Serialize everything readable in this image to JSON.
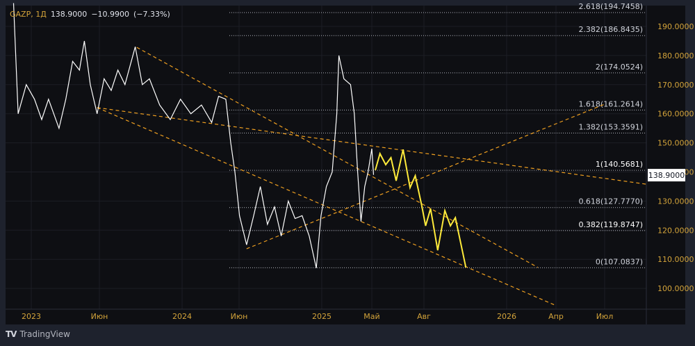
{
  "legend": {
    "symbol": "GAZP, 1Д",
    "price": "138.9000",
    "change": "−10.9900",
    "change_pct": "(−7.33%)"
  },
  "branding": {
    "name": "TradingView"
  },
  "colors": {
    "background": "#0e0f13",
    "price_line": "#ffffff",
    "projection": "#ffeb3b",
    "trendlines": "#f0a020",
    "axis_text": "#d4a43a",
    "fib_text": "#d1d4dc"
  },
  "chart_data": {
    "type": "line",
    "ylim": [
      95,
      195
    ],
    "grid": true,
    "y_ticks": [
      100,
      110,
      120,
      130,
      140,
      150,
      160,
      170,
      180,
      190
    ],
    "y_tick_labels": [
      "100.0000",
      "110.0000",
      "120.0000",
      "130.0000",
      "140.0000",
      "150.0000",
      "160.0000",
      "170.0000",
      "180.0000",
      "190.0000"
    ],
    "x_ticks": [
      {
        "label": "2023",
        "date": "2023-01-01"
      },
      {
        "label": "Июн",
        "date": "2023-06-01"
      },
      {
        "label": "2024",
        "date": "2024-01-01"
      },
      {
        "label": "Июн",
        "date": "2024-06-01"
      },
      {
        "label": "2025",
        "date": "2025-01-01"
      },
      {
        "label": "Май",
        "date": "2025-05-01"
      },
      {
        "label": "Авг",
        "date": "2025-08-01"
      },
      {
        "label": "2026",
        "date": "2026-01-01"
      },
      {
        "label": "Апр",
        "date": "2026-04-01"
      },
      {
        "label": "Июл",
        "date": "2026-07-01"
      }
    ],
    "last_price": {
      "value": 138.9,
      "label": "138.9000"
    },
    "price": [
      [
        "2022-11-22",
        198
      ],
      [
        "2022-12-02",
        160
      ],
      [
        "2022-12-20",
        170
      ],
      [
        "2023-01-08",
        165
      ],
      [
        "2023-01-24",
        158
      ],
      [
        "2023-02-09",
        165
      ],
      [
        "2023-03-02",
        155
      ],
      [
        "2023-03-17",
        165
      ],
      [
        "2023-04-02",
        178
      ],
      [
        "2023-04-17",
        175
      ],
      [
        "2023-04-28",
        185
      ],
      [
        "2023-05-11",
        170
      ],
      [
        "2023-05-26",
        160
      ],
      [
        "2023-06-13",
        172
      ],
      [
        "2023-07-01",
        168
      ],
      [
        "2023-07-18",
        175
      ],
      [
        "2023-08-06",
        170
      ],
      [
        "2023-09-02",
        183
      ],
      [
        "2023-09-20",
        170
      ],
      [
        "2023-10-08",
        172
      ],
      [
        "2023-11-04",
        163
      ],
      [
        "2023-12-01",
        158
      ],
      [
        "2023-12-27",
        165
      ],
      [
        "2024-01-24",
        160
      ],
      [
        "2024-02-22",
        163
      ],
      [
        "2024-03-19",
        157
      ],
      [
        "2024-04-07",
        166
      ],
      [
        "2024-04-26",
        165
      ],
      [
        "2024-05-09",
        150
      ],
      [
        "2024-05-20",
        140
      ],
      [
        "2024-06-02",
        125
      ],
      [
        "2024-06-20",
        115
      ],
      [
        "2024-07-08",
        125
      ],
      [
        "2024-07-25",
        135
      ],
      [
        "2024-08-13",
        122
      ],
      [
        "2024-09-01",
        128
      ],
      [
        "2024-09-18",
        118
      ],
      [
        "2024-10-06",
        130
      ],
      [
        "2024-10-23",
        124
      ],
      [
        "2024-11-11",
        125
      ],
      [
        "2024-11-29",
        118
      ],
      [
        "2024-12-17",
        107
      ],
      [
        "2024-12-29",
        125
      ],
      [
        "2025-01-12",
        135
      ],
      [
        "2025-01-26",
        140
      ],
      [
        "2025-02-07",
        160
      ],
      [
        "2025-02-12",
        180
      ],
      [
        "2025-02-24",
        172
      ],
      [
        "2025-03-10",
        170
      ],
      [
        "2025-03-19",
        160
      ],
      [
        "2025-03-27",
        140
      ],
      [
        "2025-04-05",
        123
      ],
      [
        "2025-04-14",
        135
      ],
      [
        "2025-04-22",
        140
      ],
      [
        "2025-05-01",
        148
      ],
      [
        "2025-05-04",
        139
      ]
    ],
    "projection": [
      [
        "2025-05-07",
        140.6
      ],
      [
        "2025-05-15",
        146.3
      ],
      [
        "2025-05-25",
        142.5
      ],
      [
        "2025-06-04",
        144.9
      ],
      [
        "2025-06-13",
        137.0
      ],
      [
        "2025-06-25",
        147.7
      ],
      [
        "2025-07-07",
        134.6
      ],
      [
        "2025-07-16",
        138.7
      ],
      [
        "2025-07-27",
        128.6
      ],
      [
        "2025-08-04",
        121.5
      ],
      [
        "2025-08-13",
        127.4
      ],
      [
        "2025-08-26",
        113.1
      ],
      [
        "2025-09-09",
        126.7
      ],
      [
        "2025-09-19",
        121.5
      ],
      [
        "2025-09-28",
        124.3
      ],
      [
        "2025-10-17",
        107.2
      ]
    ],
    "trendlines": [
      [
        [
          "2023-09-06",
          182.8
        ],
        [
          "2026-02-28",
          107.2
        ]
      ],
      [
        [
          "2023-05-26",
          162.1
        ],
        [
          "2026-09-18",
          135.8
        ]
      ],
      [
        [
          "2023-05-26",
          162.1
        ],
        [
          "2026-04-01",
          94.1
        ]
      ],
      [
        [
          "2024-06-20",
          113.6
        ],
        [
          "2026-07-01",
          163.3
        ]
      ]
    ],
    "fib_levels": [
      {
        "ratio": "2.618",
        "value": 194.7458,
        "label": "2.618(194.7458)"
      },
      {
        "ratio": "2.382",
        "value": 186.8435,
        "label": "2.382(186.8435)"
      },
      {
        "ratio": "2",
        "value": 174.0524,
        "label": "2(174.0524)"
      },
      {
        "ratio": "1.618",
        "value": 161.2614,
        "label": "1.618(161.2614)"
      },
      {
        "ratio": "1.382",
        "value": 153.3591,
        "label": "1.382(153.3591)"
      },
      {
        "ratio": "1",
        "value": 140.5681,
        "label": "1(140.5681)"
      },
      {
        "ratio": "0.618",
        "value": 127.777,
        "label": "0.618(127.7770)"
      },
      {
        "ratio": "0.382",
        "value": 119.8747,
        "label": "0.382(119.8747)"
      },
      {
        "ratio": "0",
        "value": 107.0837,
        "label": "0(107.0837)"
      }
    ]
  }
}
